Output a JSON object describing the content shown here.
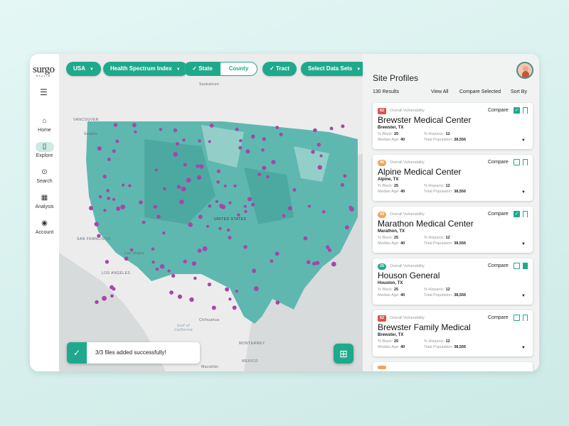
{
  "brand": {
    "logo": "surgo",
    "sub": "HEALTH"
  },
  "sidebar": {
    "items": [
      {
        "label": "Home",
        "icon": "home-icon",
        "glyph": "⌂"
      },
      {
        "label": "Explore",
        "icon": "map-icon",
        "glyph": "▯",
        "active": true
      },
      {
        "label": "Search",
        "icon": "search-icon",
        "glyph": "⊙"
      },
      {
        "label": "Analysis",
        "icon": "dashboard-icon",
        "glyph": "▦"
      },
      {
        "label": "Account",
        "icon": "account-icon",
        "glyph": "◉"
      }
    ]
  },
  "filters": {
    "country": "USA",
    "index": "Health Spectrum Index",
    "state": "State",
    "county": "County",
    "tract": "Tract",
    "datasets": "Select Data Sets"
  },
  "map": {
    "labels": {
      "saskatoon": "Saskatoon",
      "vancouver": "VANCOUVER",
      "seattle": "Seattle",
      "us": "UNITED STATES",
      "sf": "SAN FRANCISCO",
      "la": "LOS ANGELES",
      "lv": "Las Vegas",
      "chihuahua": "Chihuahua",
      "gulf": "Gulf of California",
      "monterrey": "MONTERREY",
      "mexico": "MEXICO",
      "mazatlan": "Mazatlán"
    },
    "colors": {
      "fill": "#5fb8b0",
      "dots": "#a348a8",
      "land": "#eeeeee",
      "water": "#d7dbdc"
    }
  },
  "toast": {
    "message": "3/3 files added successfully!"
  },
  "panel": {
    "title": "Site Profiles",
    "results": "130 Results",
    "view_all": "View All",
    "compare_selected": "Compare Selected",
    "sort_by": "Sort By",
    "compare_label": "Compare",
    "vuln_label": "Overall Vulnerability",
    "stat_labels": {
      "black": "% Black:",
      "hispanic": "% Hispanic:",
      "age": "Median Age:",
      "pop": "Total Population:"
    },
    "cards": [
      {
        "score": "62",
        "color": "#d9534f",
        "name": "Brewster Medical Center",
        "location": "Brewster, TX",
        "black": "25",
        "hispanic": "12",
        "age": "40",
        "pop": "38,556",
        "compared": true,
        "bookmarked": false
      },
      {
        "score": "46",
        "color": "#f0a55a",
        "name": "Alpine Medical Center",
        "location": "Alpine, TX",
        "black": "25",
        "hispanic": "12",
        "age": "40",
        "pop": "38,556",
        "compared": false,
        "bookmarked": false
      },
      {
        "score": "43",
        "color": "#f0a55a",
        "name": "Marathon Medical Center",
        "location": "Marathon, TX",
        "black": "25",
        "hispanic": "12",
        "age": "40",
        "pop": "38,556",
        "compared": true,
        "bookmarked": false
      },
      {
        "score": "25",
        "color": "#1fa98c",
        "name": "Houson General",
        "location": "Houston, TX",
        "black": "25",
        "hispanic": "12",
        "age": "40",
        "pop": "38,556",
        "compared": false,
        "bookmarked": true
      },
      {
        "score": "62",
        "color": "#d9534f",
        "name": "Brewster Family Medical",
        "location": "Brewster, TX",
        "black": "25",
        "hispanic": "12",
        "age": "40",
        "pop": "38,556",
        "compared": false,
        "bookmarked": false
      }
    ]
  },
  "accent": "#1fa98c"
}
